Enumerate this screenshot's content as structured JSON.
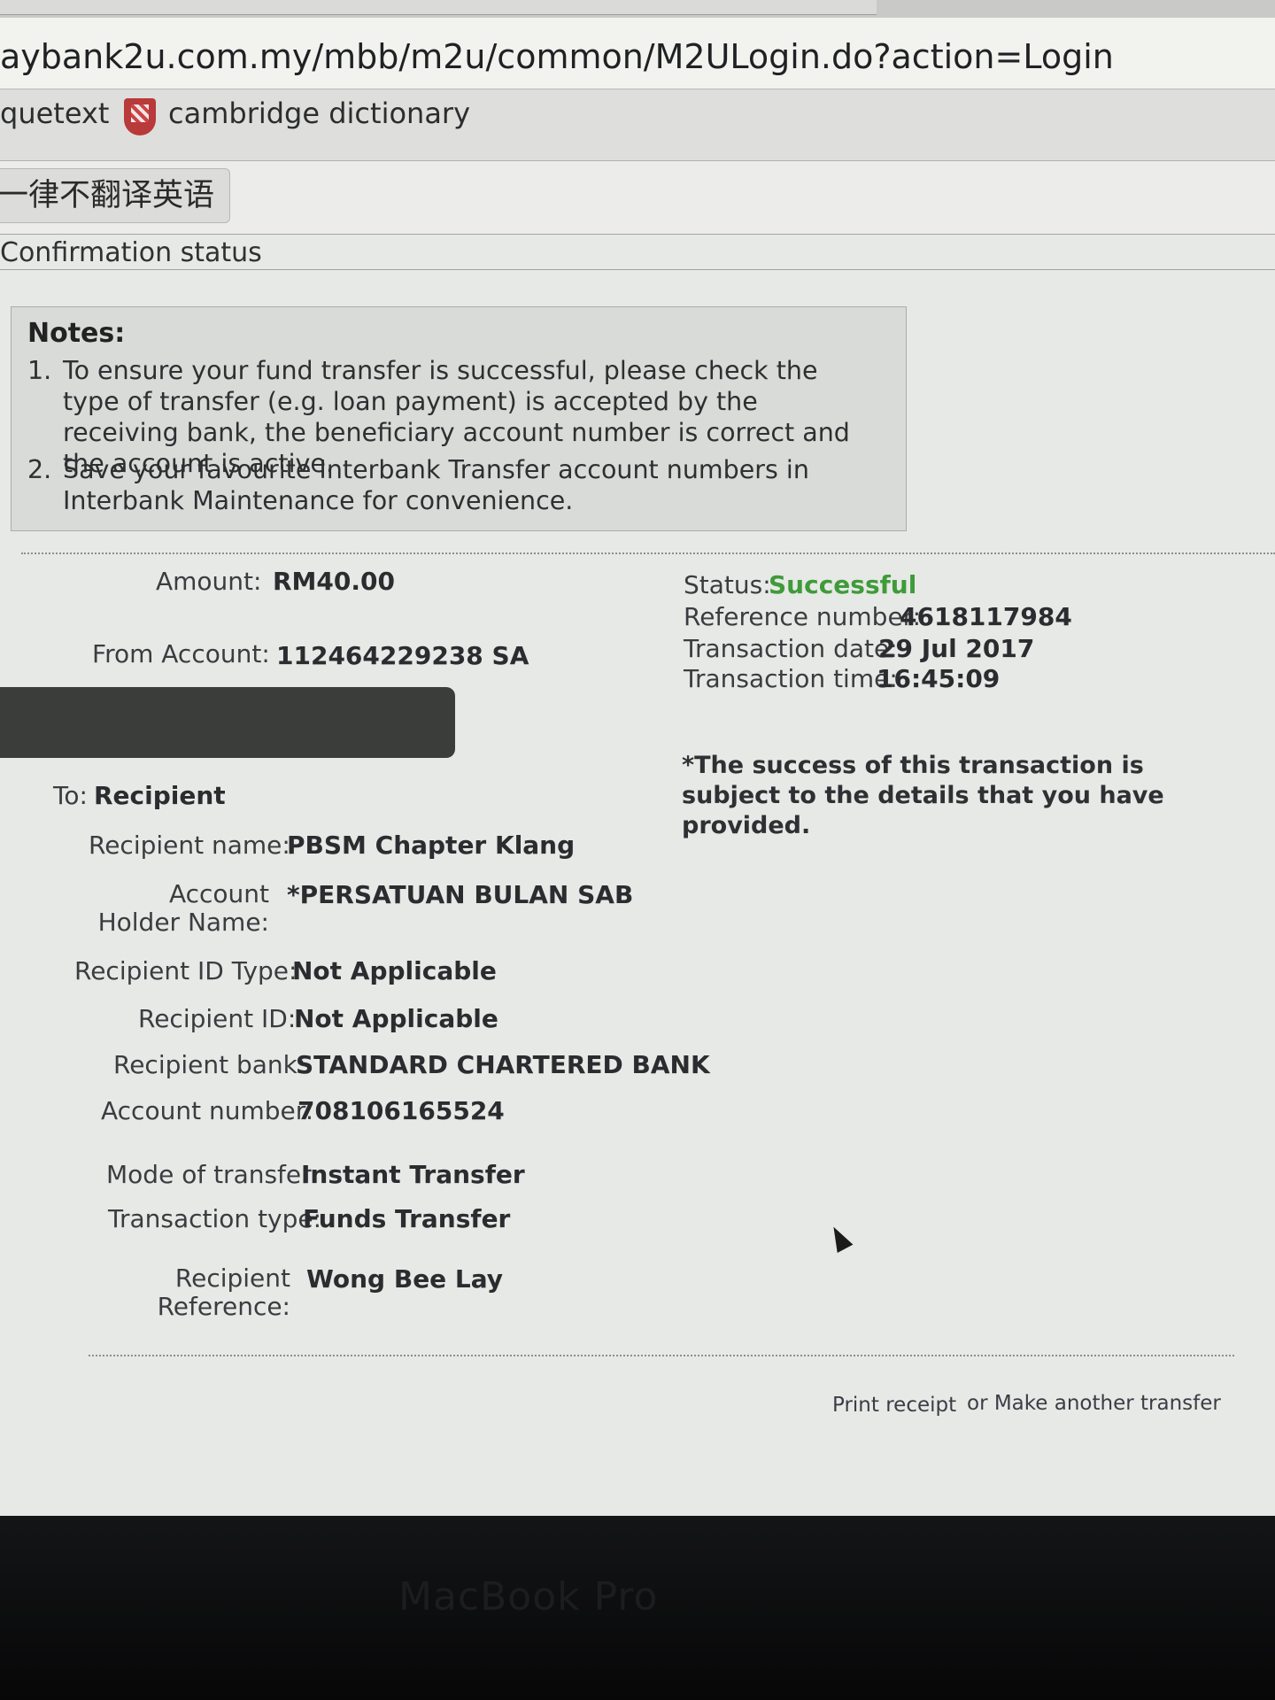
{
  "browser": {
    "url": "aybank2u.com.my/mbb/m2u/common/M2ULogin.do?action=Login",
    "bookmarks": [
      "quetext",
      "cambridge dictionary"
    ],
    "translate_button": "一律不翻译英语"
  },
  "page": {
    "title": "Confirmation status"
  },
  "notes": {
    "title": "Notes:",
    "items": [
      {
        "num": "1.",
        "text": "To ensure your fund transfer is successful, please check the type of transfer (e.g. loan payment) is accepted by the receiving bank, the beneficiary account number is correct and the account is active."
      },
      {
        "num": "2.",
        "text": "Save your favourite Interbank Transfer account numbers in Interbank Maintenance for convenience."
      }
    ]
  },
  "transfer": {
    "amount_label": "Amount:",
    "amount": "RM40.00",
    "from_label": "From Account:",
    "from_value": "112464229238 SA",
    "to_label": "To:",
    "to_value": "Recipient",
    "rows": [
      {
        "label": "Recipient name:",
        "value": "PBSM Chapter Klang"
      },
      {
        "label": "Account Holder Name:",
        "value": "*PERSATUAN BULAN SAB"
      },
      {
        "label": "Recipient ID Type:",
        "value": "Not Applicable"
      },
      {
        "label": "Recipient ID:",
        "value": "Not Applicable"
      },
      {
        "label": "Recipient bank:",
        "value": "STANDARD CHARTERED BANK"
      },
      {
        "label": "Account number:",
        "value": "708106165524"
      },
      {
        "label": "Mode of transfer:",
        "value": "Instant Transfer"
      },
      {
        "label": "Transaction type:",
        "value": "Funds Transfer"
      },
      {
        "label": "Recipient Reference:",
        "value": "Wong Bee Lay"
      }
    ]
  },
  "status": {
    "status_label": "Status:",
    "status_value": "Successful",
    "ref_label": "Reference number:",
    "ref_value": "4618117984",
    "date_label": "Transaction date:",
    "date_value": "29 Jul 2017",
    "time_label": "Transaction time:",
    "time_value": "16:45:09",
    "note": "*The success of this transaction is subject to the details that you have provided.",
    "status_color": "#3f9b3a"
  },
  "actions": {
    "print": "Print receipt",
    "or_make": "or Make another transfer"
  },
  "laptop": {
    "brand": "MacBook Pro"
  }
}
